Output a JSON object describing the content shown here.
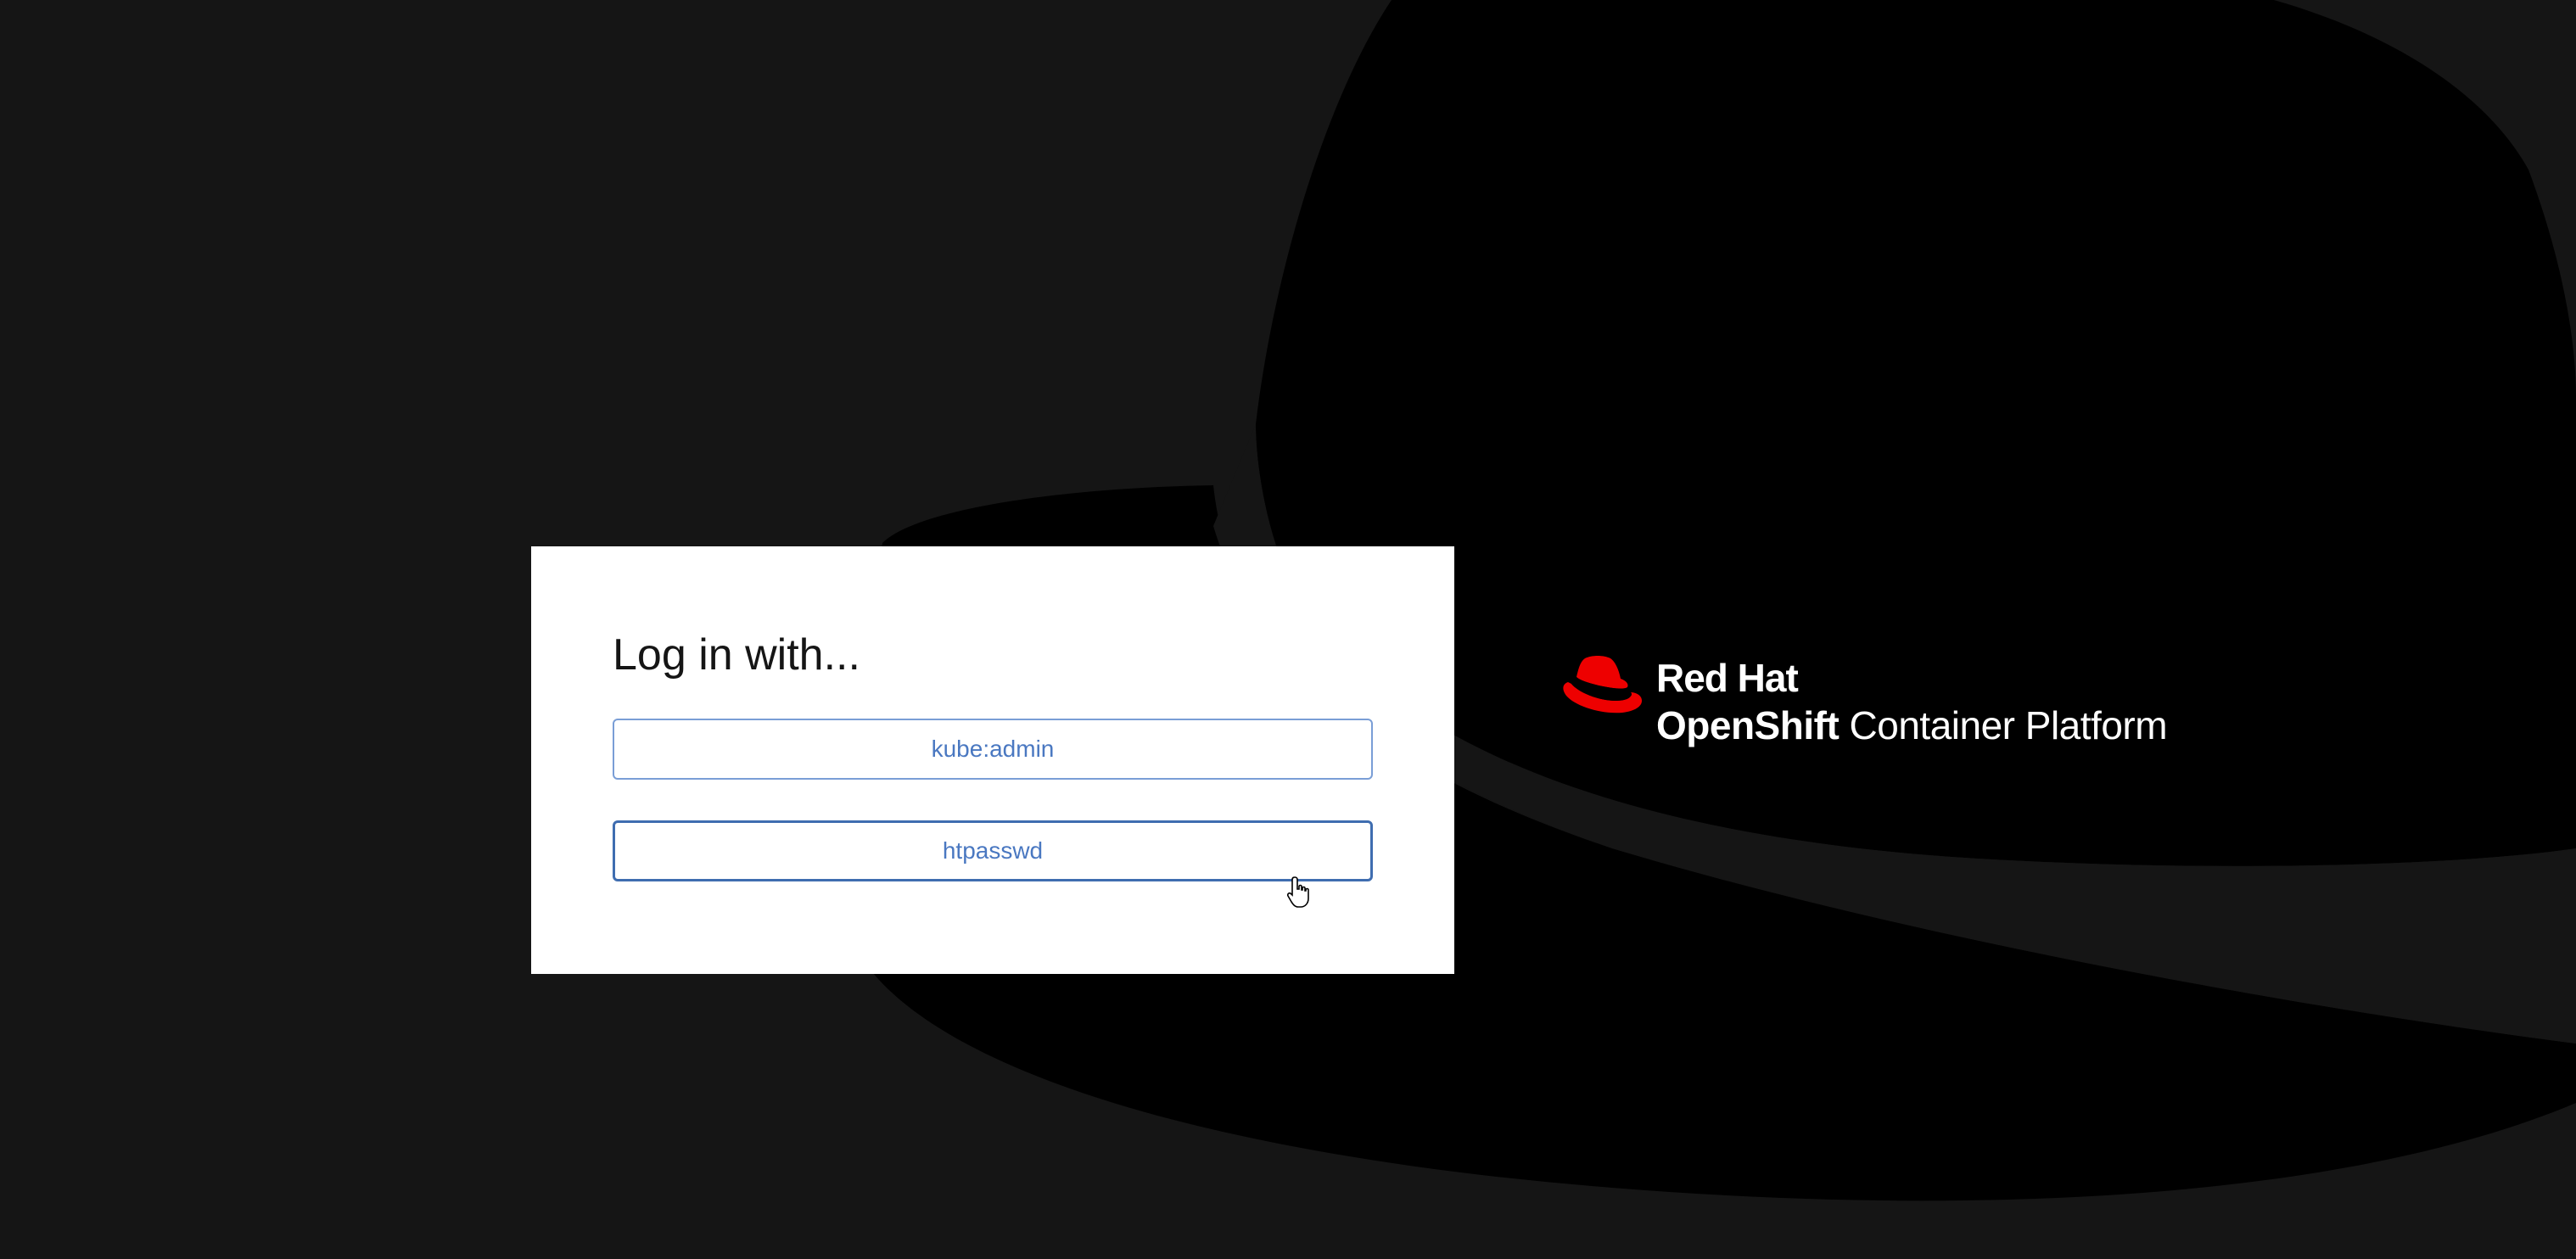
{
  "login": {
    "title": "Log in with...",
    "providers": [
      {
        "label": "kube:admin"
      },
      {
        "label": "htpasswd"
      }
    ]
  },
  "brand": {
    "company": "Red Hat",
    "product_bold": "OpenShift",
    "product_rest": " Container Platform"
  },
  "colors": {
    "background": "#151515",
    "hat_shape": "#000000",
    "brand_red": "#ee0000",
    "button_text": "#4a78c1",
    "button_border": "#7a9ed6"
  },
  "icons": {
    "logo": "red-hat-fedora-icon",
    "pointer": "hand-pointer-icon"
  }
}
